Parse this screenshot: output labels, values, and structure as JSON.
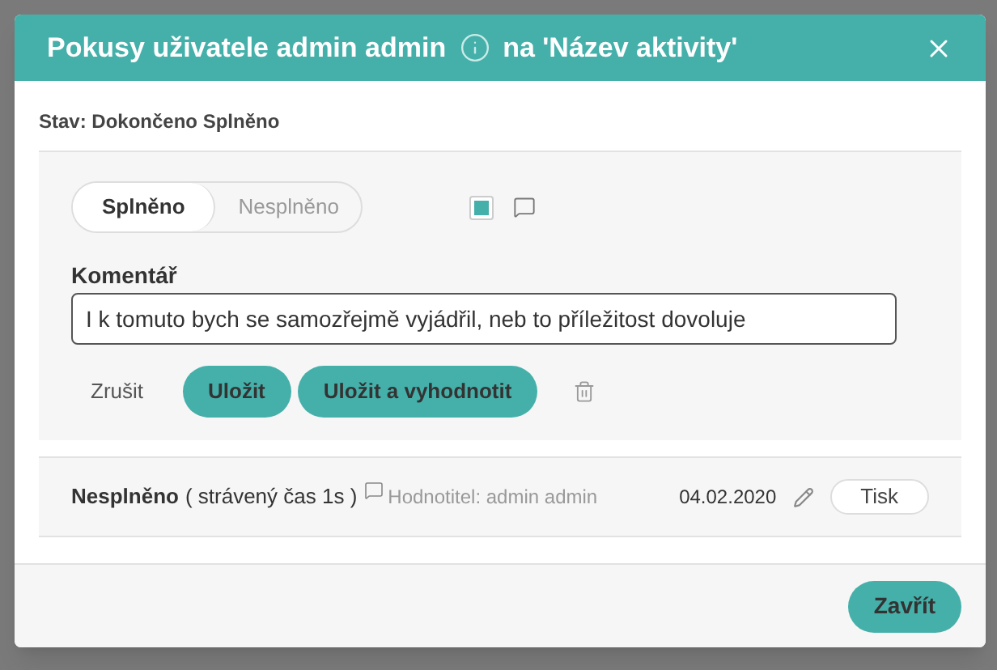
{
  "dialog": {
    "title_prefix": "Pokusy uživatele admin admin",
    "title_suffix": "na 'Název aktivity'",
    "status": "Stav: Dokončeno Splněno",
    "result_options": [
      {
        "label": "Splněno",
        "selected": true
      },
      {
        "label": "Nesplněno",
        "selected": false
      }
    ],
    "checkbox": {
      "checked": true
    },
    "comment": {
      "label": "Komentář",
      "value": "I k tomuto bych se samozřejmě vyjádřil, neb to příležitost dovoluje"
    },
    "actions": [
      {
        "kind": "link",
        "label": "Zrušit"
      },
      {
        "kind": "primary",
        "label": "Uložit"
      },
      {
        "kind": "primary",
        "label": "Uložit a vyhodnotit"
      }
    ],
    "attempt": {
      "result": "Nesplněno",
      "time": "( strávený čas 1s )",
      "evaluator": "Hodnotitel: admin admin",
      "date": "04.02.2020",
      "print": "Tisk"
    },
    "close_label": "Zavřít"
  }
}
